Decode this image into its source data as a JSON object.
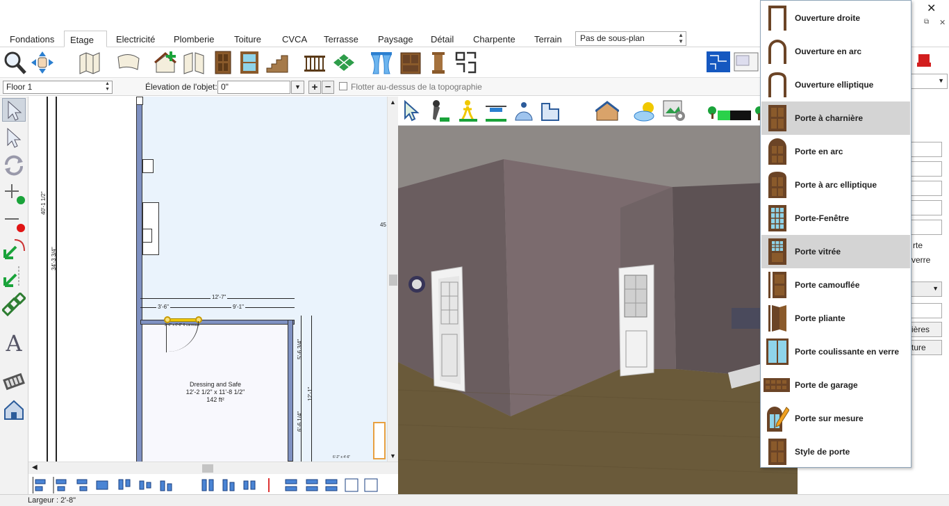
{
  "window": {
    "close_glyph": "✕",
    "restore_glyph": "⧉",
    "minimize_glyph": "–"
  },
  "tabs": [
    "Fondations",
    "Etage",
    "Electricité",
    "Plomberie",
    "Toiture",
    "CVCA",
    "Terrasse",
    "Paysage",
    "Détail",
    "Charpente",
    "Terrain"
  ],
  "active_tab": "Etage",
  "subplan": {
    "value": "Pas de sous-plan"
  },
  "options_bar": {
    "floor_value": "Floor 1",
    "elevation_label": "Élevation de l'objet:",
    "elevation_value": "0\"",
    "float_label": "Flotter au-dessus de la topographie"
  },
  "plan": {
    "room_name": "Dressing and Safe",
    "room_dims": "12'-2 1/2\" x 11'-8 1/2\"",
    "room_area": "142 ft²",
    "dim_top_total": "12'-7\"",
    "dim_left": "3'-6\"",
    "dim_right": "9'-1\"",
    "dim_v1": "40'-1 1/2\"",
    "dim_v2": "34'-3 3/4\"",
    "dim_v3": "5'-6 3/4\"",
    "dim_v4": "12'-1\"",
    "dim_v5": "6'-6 1/4\"",
    "door_label": "2'-6\" x 6'-8\" 6 carreaux",
    "edge_label": "45",
    "bottom_dim": "6'-2\" x 4'-6\""
  },
  "status": {
    "text": "Largeur : 2'-8\""
  },
  "right_panel": {
    "text1": "rte",
    "text2": "verre",
    "btn1": "ières",
    "btn2": "ture"
  },
  "door_menu": [
    {
      "label": "Ouverture droite",
      "icon": "opening-straight-icon",
      "highlighted": false
    },
    {
      "label": "Ouverture en arc",
      "icon": "opening-arch-icon",
      "highlighted": false
    },
    {
      "label": "Ouverture elliptique",
      "icon": "opening-elliptic-icon",
      "highlighted": false
    },
    {
      "label": "Porte à charnière",
      "icon": "hinged-door-icon",
      "highlighted": true
    },
    {
      "label": "Porte en arc",
      "icon": "arched-door-icon",
      "highlighted": false
    },
    {
      "label": "Porte à arc elliptique",
      "icon": "elliptic-arch-door-icon",
      "highlighted": false
    },
    {
      "label": "Porte-Fenêtre",
      "icon": "french-door-icon",
      "highlighted": false
    },
    {
      "label": "Porte vitrée",
      "icon": "glass-door-icon",
      "highlighted": true
    },
    {
      "label": "Porte camouflée",
      "icon": "pocket-door-icon",
      "highlighted": false
    },
    {
      "label": "Porte pliante",
      "icon": "bifold-door-icon",
      "highlighted": false
    },
    {
      "label": "Porte coulissante en verre",
      "icon": "sliding-glass-door-icon",
      "highlighted": false
    },
    {
      "label": "Porte de garage",
      "icon": "garage-door-icon",
      "highlighted": false
    },
    {
      "label": "Porte sur mesure",
      "icon": "custom-door-icon",
      "highlighted": false
    },
    {
      "label": "Style de porte",
      "icon": "door-style-icon",
      "highlighted": false
    }
  ],
  "colors": {
    "wall": "#7f91c2",
    "door_brown": "#6b4426",
    "highlight": "#d4d4d4",
    "menu_border": "#8ea4b8"
  }
}
